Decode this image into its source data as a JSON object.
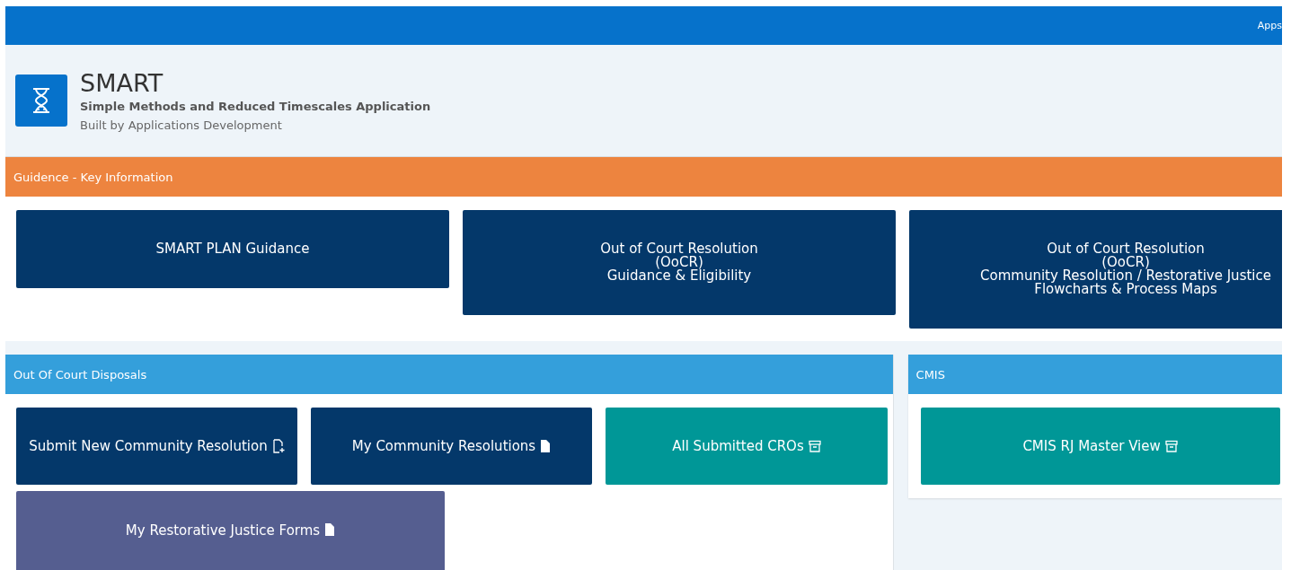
{
  "top_bar": {
    "menu_label": "Apps"
  },
  "app_header": {
    "title": "SMART",
    "subtitle": "Simple Methods and Reduced Timescales Application",
    "byline": "Built by Applications Development"
  },
  "guidance": {
    "title": "Guidence - Key Information",
    "tiles": [
      {
        "lines": [
          "SMART PLAN Guidance"
        ]
      },
      {
        "lines": [
          "Out of Court Resolution",
          "(OoCR)",
          "Guidance & Eligibility"
        ]
      },
      {
        "lines": [
          "Out of Court Resolution",
          "(OoCR)",
          "Community Resolution / Restorative Justice",
          "Flowcharts & Process Maps"
        ]
      }
    ]
  },
  "out_of_court_disposals": {
    "title": "Out Of Court Disposals",
    "tiles": [
      {
        "label": "Submit New Community Resolution",
        "kind": "create",
        "color": "#04386a"
      },
      {
        "label": "My Community Resolutions",
        "kind": "document",
        "color": "#04386a"
      },
      {
        "label": "All Submitted CROs",
        "kind": "store",
        "color": "#009797"
      },
      {
        "label": "My Restorative Justice Forms",
        "kind": "document",
        "color": "#555e90"
      }
    ]
  },
  "cmis": {
    "title": "CMIS",
    "tiles": [
      {
        "label": "CMIS RJ Master View",
        "kind": "store",
        "color": "#009797"
      }
    ]
  }
}
